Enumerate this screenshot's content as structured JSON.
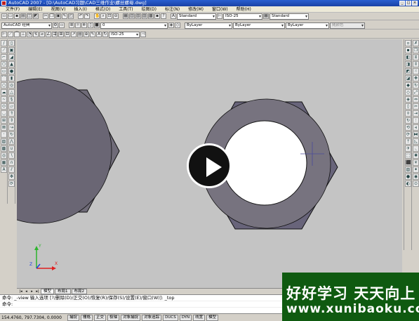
{
  "window": {
    "title": "AutoCAD 2007 - [D:\\AutoCAD习题\\CAD三维作业\\螺丝螺母.dwg]"
  },
  "menu": [
    "文件(F)",
    "编辑(E)",
    "视图(V)",
    "插入(I)",
    "格式(O)",
    "工具(T)",
    "绘图(D)",
    "标注(N)",
    "修改(M)",
    "窗口(W)",
    "帮助(H)"
  ],
  "toolbar": {
    "workspace": "AutoCAD 经典",
    "text_style": "Standard",
    "dim_style": "ISO-25",
    "table_style": "Standard",
    "layer": "0",
    "color": "ByLayer",
    "linetype": "ByLayer",
    "lineweight": "ByLayer",
    "plot_style": "随颜色",
    "dim_style_2": "ISO-25"
  },
  "tabs": {
    "model": "模型",
    "layout1": "布局1",
    "layout2": "布局2"
  },
  "ucs": {
    "x": "X",
    "y": "Y",
    "z": "Z"
  },
  "command": {
    "line1": "命令: _-view 输入选项 [?/删除(D)/正交(O)/恢复(R)/保存(S)/设置(E)/窗口(W)]: _top",
    "line2": "命令:"
  },
  "status": {
    "coords": "154.4760, 797.7304, 0.0000",
    "buttons": [
      "捕捉",
      "栅格",
      "正交",
      "极轴",
      "对象捕捉",
      "对象追踪",
      "DUCS",
      "DYN",
      "线宽",
      "模型"
    ]
  },
  "watermark": {
    "line1": "好好学习 天天向上",
    "line2": "www.xunibaoku.com"
  }
}
